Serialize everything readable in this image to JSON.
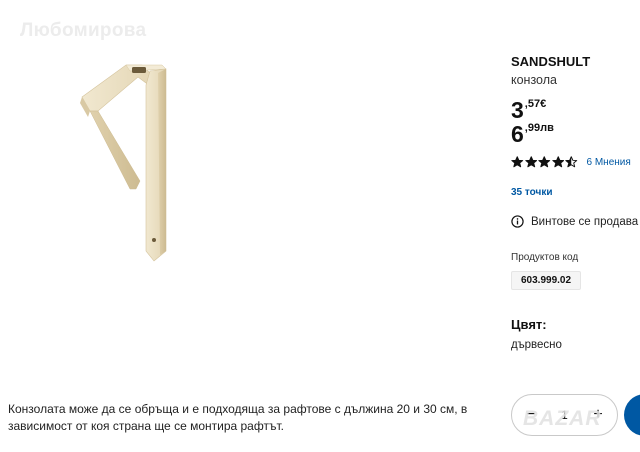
{
  "watermark": "Любомирова",
  "product": {
    "name": "SANDSHULT",
    "type": "конзола",
    "price_eur": {
      "integer": "3",
      "fraction": ",57€"
    },
    "price_bgn": {
      "integer": "6",
      "fraction": ",99лв"
    },
    "rating": {
      "value": 4.5,
      "max": 5,
      "reviews_label": "6 Мнения"
    },
    "points": "35 точки",
    "availability": "Винтове се продава",
    "code_label": "Продуктов код",
    "code": "603.999.02",
    "color_label": "Цвят:",
    "color_value": "дървесно",
    "description": "Конзолата може да се обръща и е подходяща за рафтове с дължина 20 и 30 см, в зависимост от коя страна ще се монтира рафтът."
  },
  "cart": {
    "quantity": "1",
    "minus_label": "−",
    "plus_label": "+"
  },
  "corner_watermark": "BAZAR",
  "colors": {
    "accent": "#0058a3",
    "wood": "#eadfc4"
  }
}
